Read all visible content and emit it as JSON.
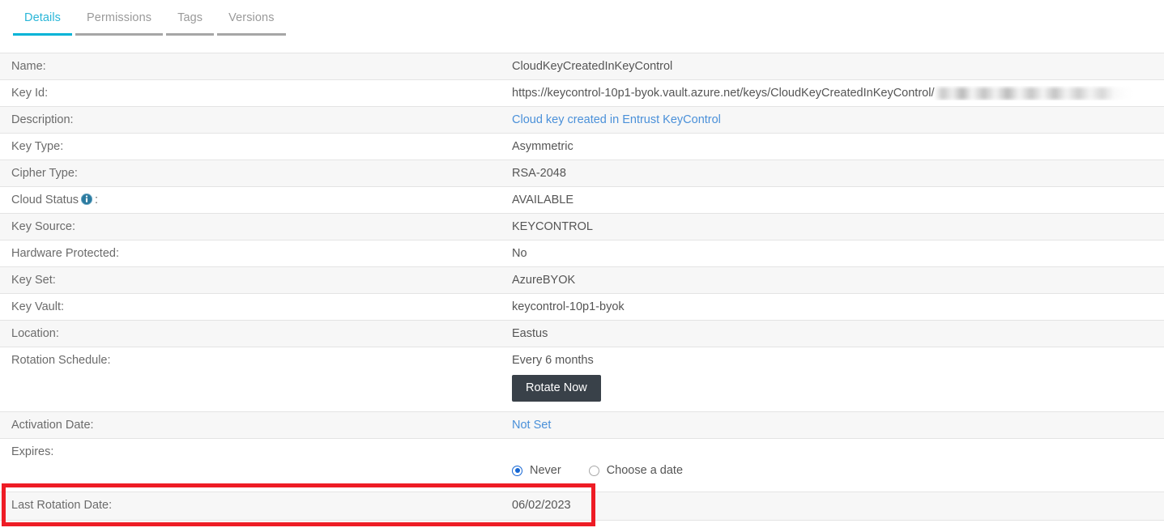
{
  "tabs": [
    {
      "label": "Details",
      "active": true
    },
    {
      "label": "Permissions",
      "active": false
    },
    {
      "label": "Tags",
      "active": false
    },
    {
      "label": "Versions",
      "active": false
    }
  ],
  "details": {
    "name": {
      "label": "Name:",
      "value": "CloudKeyCreatedInKeyControl"
    },
    "key_id": {
      "label": "Key Id:",
      "value": "https://keycontrol-10p1-byok.vault.azure.net/keys/CloudKeyCreatedInKeyControl/"
    },
    "description": {
      "label": "Description:",
      "value": "Cloud key created in Entrust KeyControl"
    },
    "key_type": {
      "label": "Key Type:",
      "value": "Asymmetric"
    },
    "cipher_type": {
      "label": "Cipher Type:",
      "value": "RSA-2048"
    },
    "cloud_status": {
      "label_prefix": "Cloud Status",
      "label_suffix": ":",
      "value": "AVAILABLE",
      "icon": "info-icon"
    },
    "key_source": {
      "label": "Key Source:",
      "value": "KEYCONTROL"
    },
    "hardware": {
      "label": "Hardware Protected:",
      "value": "No"
    },
    "key_set": {
      "label": "Key Set:",
      "value": "AzureBYOK"
    },
    "key_vault": {
      "label": "Key Vault:",
      "value": "keycontrol-10p1-byok"
    },
    "location": {
      "label": "Location:",
      "value": "Eastus"
    },
    "rotation": {
      "label": "Rotation Schedule:",
      "value": "Every 6 months",
      "button": "Rotate Now"
    },
    "activation_date": {
      "label": "Activation Date:",
      "value": "Not Set"
    },
    "expires": {
      "label": "Expires:"
    },
    "last_rotation": {
      "label": "Last Rotation Date:",
      "value": "06/02/2023"
    }
  },
  "expires_options": [
    {
      "label": "Never",
      "selected": true
    },
    {
      "label": "Choose a date",
      "selected": false
    }
  ],
  "colors": {
    "tab_active": "#00b3d7",
    "tab_inactive": "#a6a6a6",
    "link": "#4a90d9",
    "button_bg": "#394149",
    "radio_selected": "#1667d4",
    "highlight": "#ee1c25",
    "row_alt_bg": "#f7f7f7",
    "info_icon": "#2c7ba0"
  }
}
